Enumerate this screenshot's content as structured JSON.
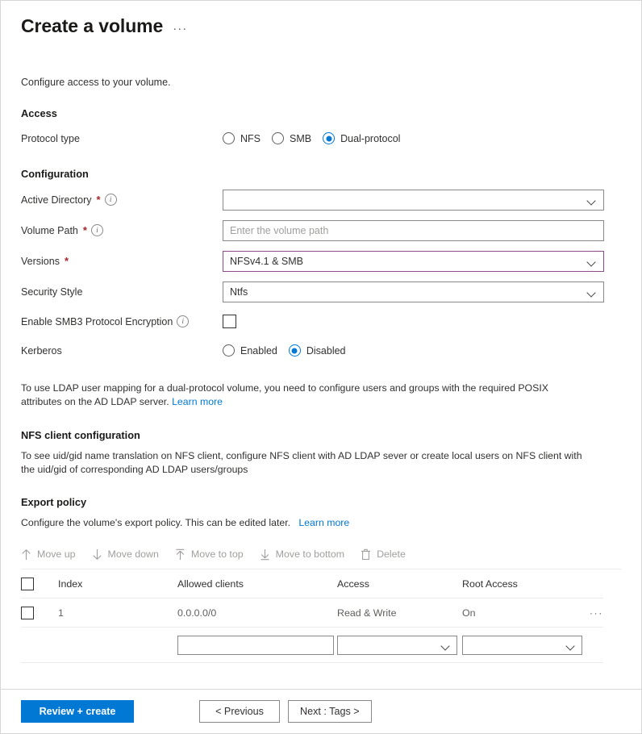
{
  "header": {
    "title": "Create a volume",
    "more_label": "···"
  },
  "intro": "Configure access to your volume.",
  "access": {
    "section_title": "Access",
    "protocol_label": "Protocol type",
    "protocol_options": [
      {
        "label": "NFS",
        "selected": false
      },
      {
        "label": "SMB",
        "selected": false
      },
      {
        "label": "Dual-protocol",
        "selected": true
      }
    ]
  },
  "configuration": {
    "section_title": "Configuration",
    "active_directory": {
      "label": "Active Directory",
      "required_mark": "*",
      "value": "",
      "has_info": true
    },
    "volume_path": {
      "label": "Volume Path",
      "required_mark": "*",
      "placeholder": "Enter the volume path",
      "value": "",
      "has_info": true
    },
    "versions": {
      "label": "Versions",
      "required_mark": "*",
      "value": "NFSv4.1 & SMB",
      "border_color": "#8c4a86"
    },
    "security_style": {
      "label": "Security Style",
      "value": "Ntfs"
    },
    "smb3_encryption": {
      "label": "Enable SMB3 Protocol Encryption",
      "checked": false,
      "has_info": true
    },
    "kerberos": {
      "label": "Kerberos",
      "options": [
        {
          "label": "Enabled",
          "selected": false
        },
        {
          "label": "Disabled",
          "selected": true
        }
      ]
    }
  },
  "ldap_note": {
    "text": "To use LDAP user mapping for a dual-protocol volume, you need to configure users and groups with the required POSIX attributes on the AD LDAP server.",
    "link": "Learn more"
  },
  "nfs_client": {
    "title": "NFS client configuration",
    "text": "To see uid/gid name translation on NFS client, configure NFS client with AD LDAP sever or create local users on NFS client with the uid/gid of corresponding AD LDAP users/groups"
  },
  "export_policy": {
    "title": "Export policy",
    "description": "Configure the volume's export policy. This can be edited later.",
    "link": "Learn more",
    "commands": [
      {
        "label": "Move up",
        "icon": "arrow-up-icon"
      },
      {
        "label": "Move down",
        "icon": "arrow-down-icon"
      },
      {
        "label": "Move to top",
        "icon": "arrow-to-top-icon"
      },
      {
        "label": "Move to bottom",
        "icon": "arrow-to-bottom-icon"
      },
      {
        "label": "Delete",
        "icon": "trash-icon"
      }
    ],
    "columns": [
      "Index",
      "Allowed clients",
      "Access",
      "Root Access"
    ],
    "rows": [
      {
        "index": "1",
        "allowed_clients": "0.0.0.0/0",
        "access": "Read & Write",
        "root_access": "On",
        "menu": "···"
      }
    ],
    "new_row": {
      "allowed_clients": "",
      "access": "",
      "root_access": ""
    }
  },
  "footer": {
    "review_create": "Review + create",
    "previous": "< Previous",
    "next": "Next : Tags >"
  },
  "colors": {
    "accent_blue": "#0078d4",
    "required_red": "#a4262c",
    "versions_border": "#8c4a86"
  }
}
